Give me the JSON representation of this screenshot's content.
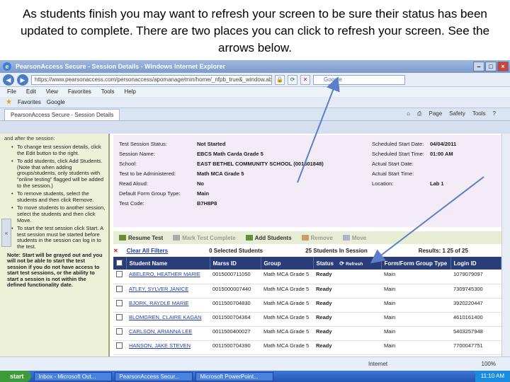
{
  "caption": "As students finish you may want to refresh your screen to be sure their status has been updated to complete.  There are two places you can click to refresh your screen.  See the arrows below.",
  "window": {
    "title": "PearsonAccess Secure - Session Details - Windows Internet Explorer",
    "address": "https://www.pearsonaccess.com/personaccess/apomanage/min/home/_nfpb_true&_window.aba",
    "search_placeholder": "Google"
  },
  "menu": [
    "File",
    "Edit",
    "View",
    "Favorites",
    "Tools",
    "Help"
  ],
  "favorites": {
    "label": "Favorites",
    "items": [
      "Google"
    ]
  },
  "tab": {
    "label": "PearsonAccess Secure - Session Details"
  },
  "tools": [
    "Page",
    "Safety",
    "Tools"
  ],
  "sidebar": {
    "intro": "and after the session:",
    "items": [
      "To change test session details, click the Edit button to the right.",
      "To add students, click Add Students. (Note that when adding groups/students, only students with \"online testing\" flagged will be added to the session.)",
      "To remove students, select the students and then click Remove.",
      "To move students to another session, select the students and then click Move.",
      "To start the test session click Start. A test session must be started before students in the session can log in to the test."
    ],
    "note": "Note: Start will be grayed out and you will not be able to start the test session if you do not have access to start test sessions, or the ability to start a session is not within the defined functionality date."
  },
  "details": {
    "left": [
      {
        "label": "Test Session Status:",
        "value": "Not Started"
      },
      {
        "label": "Session Name:",
        "value": "EBCS Math Carda Grade 5"
      },
      {
        "label": "School:",
        "value": "EAST BETHEL COMMUNITY SCHOOL (001501848)"
      },
      {
        "label": "Test to be Administered:",
        "value": "Math MCA Grade 5"
      },
      {
        "label": "Read Aloud:",
        "value": "No"
      },
      {
        "label": "Default Form Group Type:",
        "value": "Main"
      },
      {
        "label": "Test Code:",
        "value": "B7H8P8"
      }
    ],
    "right": [
      {
        "label": "Scheduled Start Date:",
        "value": "04/04/2011"
      },
      {
        "label": "Scheduled Start Time:",
        "value": "01:00 AM"
      },
      {
        "label": "Actual Start Date:",
        "value": ""
      },
      {
        "label": "Actual Start Time:",
        "value": ""
      },
      {
        "label": "Location:",
        "value": "Lab 1"
      }
    ]
  },
  "actions": [
    "Resume Test",
    "Mark Test Complete",
    "Add Students",
    "Remove",
    "Move"
  ],
  "filter": {
    "clear_label": "Clear All Filters",
    "selected": "0 Selected Students",
    "in_session": "25 Students In Session",
    "results": "Results: 1  25 of 25"
  },
  "table": {
    "headers": [
      "Student Name",
      "Marss ID",
      "Group",
      "Status",
      "Form/Form Group Type",
      "Login ID"
    ],
    "refresh_label": "Refresh",
    "rows": [
      {
        "name": "ABELERO, HEATHER MARIE",
        "marss": "0015000711050",
        "group": "Math MCA Grade 5",
        "status": "Ready",
        "form": "Main",
        "login": "1079079097"
      },
      {
        "name": "ATLEY, SYLVER JANICE",
        "marss": "0015000007440",
        "group": "Math MCA Grade 5",
        "status": "Ready",
        "form": "Main",
        "login": "7309745300"
      },
      {
        "name": "BJORK, RAYDLE MARIE",
        "marss": "0011500704830",
        "group": "Math MCA Grade 5",
        "status": "Ready",
        "form": "Main",
        "login": "3920220447"
      },
      {
        "name": "BLOMGREN, CLAIRE KAGAN",
        "marss": "0011500704364",
        "group": "Math MCA Grade 5",
        "status": "Ready",
        "form": "Main",
        "login": "4610161400"
      },
      {
        "name": "CARLSON, ARIANNA LEE",
        "marss": "0011500400027",
        "group": "Math MCA Grade 5",
        "status": "Ready",
        "form": "Main",
        "login": "5403257948"
      },
      {
        "name": "HANSON, JAKE STEVEN",
        "marss": "0011500704390",
        "group": "Math MCA Grade 5",
        "status": "Ready",
        "form": "Main",
        "login": "7700047751"
      }
    ]
  },
  "statusbar": {
    "zone": "Internet",
    "zoom": "100%"
  },
  "taskbar": {
    "start": "start",
    "tasks": [
      "Inbox - Microsoft Out...",
      "PearsonAccess Secur...",
      "Microsoft PowerPoint..."
    ],
    "clock": "11:10 AM"
  },
  "colors": {
    "header": "#2a3d7a",
    "arrow": "#5b7fc8",
    "sidebar_bg": "#ecf1d8"
  }
}
